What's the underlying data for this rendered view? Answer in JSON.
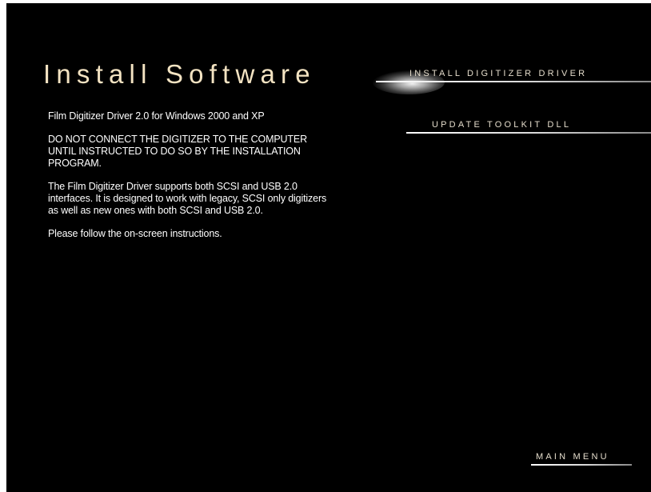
{
  "page": {
    "title": "Install Software"
  },
  "content": {
    "paragraphs": [
      "Film Digitizer Driver 2.0 for Windows 2000 and XP",
      "DO NOT CONNECT THE DIGITIZER TO THE COMPUTER UNTIL INSTRUCTED TO DO SO BY THE INSTALLATION PROGRAM.",
      "The Film Digitizer Driver supports both SCSI and USB 2.0 interfaces.  It is designed to work with legacy, SCSI only digitizers as well as new ones with both SCSI and USB 2.0.",
      "Please follow the on-screen instructions."
    ]
  },
  "menu": {
    "install_driver": "INSTALL DIGITIZER DRIVER",
    "update_toolkit": "UPDATE TOOLKIT DLL",
    "main_menu": "MAIN MENU"
  },
  "colors": {
    "background": "#000000",
    "title": "#f3e3c2",
    "menu_text": "#e4dccb",
    "body_text": "#ffffff",
    "outer_border": "#ffffff"
  }
}
